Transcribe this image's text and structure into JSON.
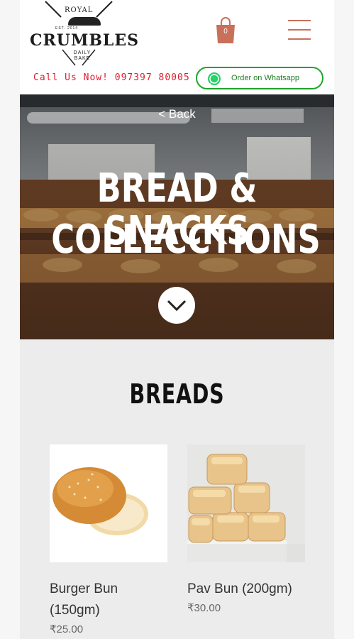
{
  "header": {
    "logo": {
      "top": "ROYAL",
      "est": "EST.     2014",
      "name": "CRUMBLES",
      "sub1": "DAILY",
      "sub2": "BAKE"
    },
    "cart_count": "0",
    "call_text": "Call Us Now! 097397 80005",
    "whatsapp_label": "Order on Whatsapp"
  },
  "hero": {
    "back_label": "< Back",
    "title_line1": "BREAD & SNACKS",
    "title_line2": "COLLECCTIONS"
  },
  "section": {
    "title": "BREADS"
  },
  "products": [
    {
      "name": "Burger Bun (150gm)",
      "price": "₹25.00"
    },
    {
      "name": "Pav Bun (200gm)",
      "price": "₹30.00"
    }
  ],
  "colors": {
    "accent": "#c9705a",
    "call": "#e01b2e",
    "whatsapp": "#1fa52a"
  }
}
